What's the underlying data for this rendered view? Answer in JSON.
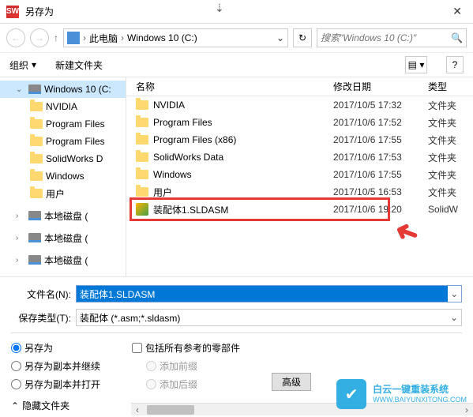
{
  "title": "另存为",
  "breadcrumb": {
    "pc": "此电脑",
    "drive": "Windows 10 (C:)"
  },
  "search": {
    "placeholder": "搜索\"Windows 10 (C:)\""
  },
  "toolbar": {
    "organize": "组织",
    "newfolder": "新建文件夹"
  },
  "tree": {
    "root": "Windows 10 (C:",
    "children": [
      "NVIDIA",
      "Program Files",
      "Program Files",
      "SolidWorks D",
      "Windows",
      "用户"
    ],
    "drives": [
      "本地磁盘 (",
      "本地磁盘 (",
      "本地磁盘 ("
    ]
  },
  "columns": {
    "name": "名称",
    "date": "修改日期",
    "type": "类型"
  },
  "files": [
    {
      "name": "NVIDIA",
      "date": "2017/10/5 17:32",
      "type": "文件夹",
      "kind": "folder"
    },
    {
      "name": "Program Files",
      "date": "2017/10/6 17:52",
      "type": "文件夹",
      "kind": "folder"
    },
    {
      "name": "Program Files (x86)",
      "date": "2017/10/6 17:55",
      "type": "文件夹",
      "kind": "folder"
    },
    {
      "name": "SolidWorks Data",
      "date": "2017/10/6 17:53",
      "type": "文件夹",
      "kind": "folder"
    },
    {
      "name": "Windows",
      "date": "2017/10/6 17:55",
      "type": "文件夹",
      "kind": "folder"
    },
    {
      "name": "用户",
      "date": "2017/10/5 16:53",
      "type": "文件夹",
      "kind": "folder"
    },
    {
      "name": "装配体1.SLDASM",
      "date": "2017/10/6 19:20",
      "type": "SolidW",
      "kind": "asm"
    }
  ],
  "filename": {
    "label": "文件名(N):",
    "value": "装配体1.SLDASM"
  },
  "filetype": {
    "label": "保存类型(T):",
    "value": "装配体 (*.asm;*.sldasm)"
  },
  "radios": {
    "saveas": "另存为",
    "copy_continue": "另存为副本并继续",
    "copy_open": "另存为副本并打开"
  },
  "checks": {
    "include_refs": "包括所有参考的零部件",
    "prefix": "添加前缀",
    "suffix": "添加后缀"
  },
  "advanced": "高级",
  "hide": "隐藏文件夹",
  "watermark": {
    "line1": "白云一键重装系统",
    "line2": "WWW.BAIYUNXITONG.COM"
  }
}
